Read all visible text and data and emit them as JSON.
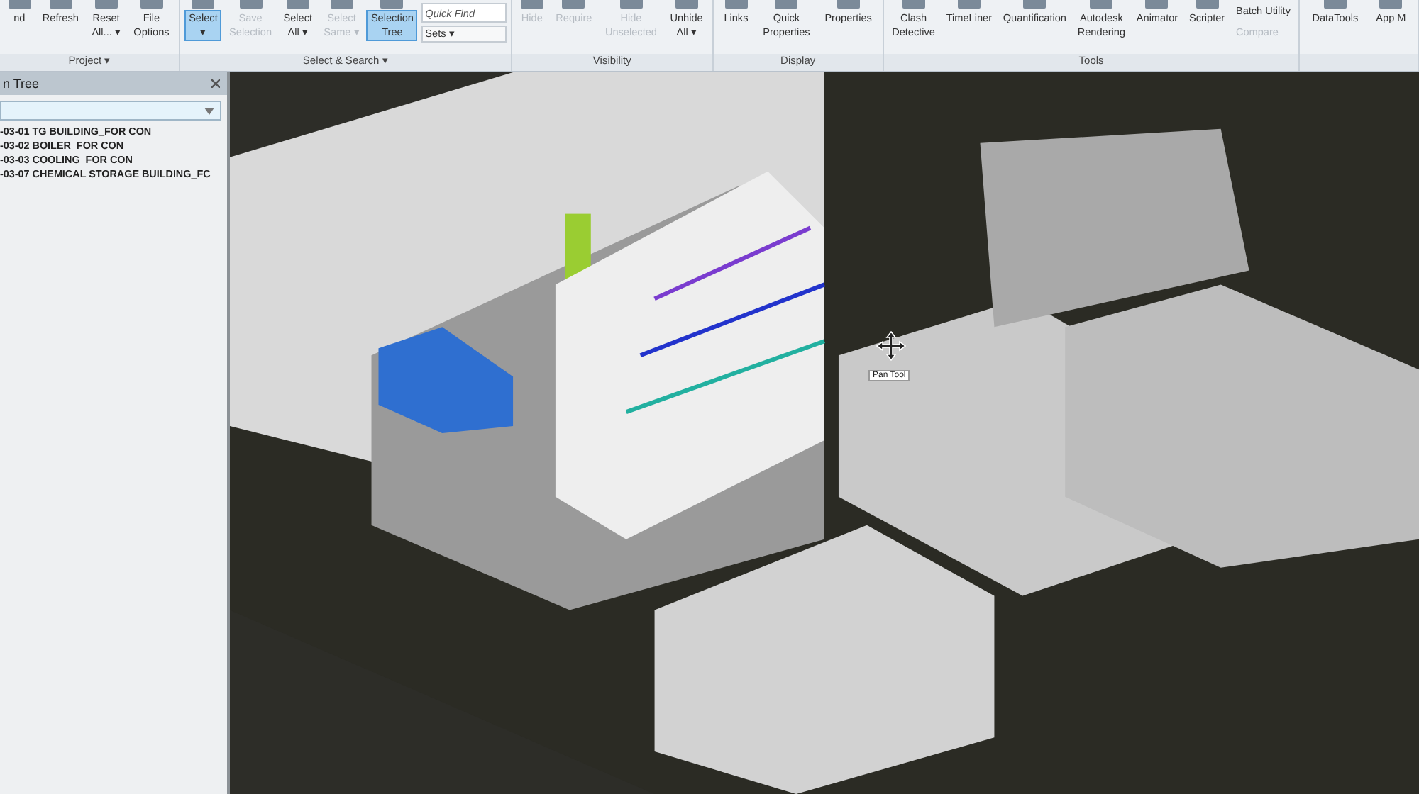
{
  "ribbon": {
    "groups": [
      {
        "label": "Project ▾",
        "items": [
          {
            "kind": "large",
            "label": "nd",
            "selected": false,
            "disabled": false
          },
          {
            "kind": "large",
            "label": "Refresh",
            "selected": false,
            "disabled": false
          },
          {
            "kind": "large",
            "label": "Reset\nAll... ▾",
            "selected": false,
            "disabled": false
          },
          {
            "kind": "large",
            "label": "File\nOptions",
            "selected": false,
            "disabled": false
          }
        ]
      },
      {
        "label": "Select & Search ▾",
        "items": [
          {
            "kind": "large",
            "label": "Select\n▾",
            "selected": true,
            "disabled": false
          },
          {
            "kind": "large",
            "label": "Save\nSelection",
            "selected": false,
            "disabled": true
          },
          {
            "kind": "large",
            "label": "Select\nAll ▾",
            "selected": false,
            "disabled": false
          },
          {
            "kind": "large",
            "label": "Select\nSame ▾",
            "selected": false,
            "disabled": true
          },
          {
            "kind": "large",
            "label": "Selection\nTree",
            "selected": true,
            "disabled": false
          },
          {
            "kind": "search",
            "placeholder": "Quick Find",
            "label": "Sets ▾",
            "selected": false,
            "disabled": false
          }
        ]
      },
      {
        "label": "Visibility",
        "items": [
          {
            "kind": "large",
            "label": "Hide",
            "selected": false,
            "disabled": true
          },
          {
            "kind": "large",
            "label": "Require",
            "selected": false,
            "disabled": true
          },
          {
            "kind": "large",
            "label": "Hide\nUnselected",
            "selected": false,
            "disabled": true
          },
          {
            "kind": "large",
            "label": "Unhide\nAll ▾",
            "selected": false,
            "disabled": false
          }
        ]
      },
      {
        "label": "Display",
        "items": [
          {
            "kind": "large",
            "label": "Links",
            "selected": false,
            "disabled": false
          },
          {
            "kind": "large",
            "label": "Quick\nProperties",
            "selected": false,
            "disabled": false
          },
          {
            "kind": "large",
            "label": "Properties",
            "selected": false,
            "disabled": false
          }
        ]
      },
      {
        "label": "Tools",
        "items": [
          {
            "kind": "large",
            "label": "Clash\nDetective",
            "selected": false,
            "disabled": false
          },
          {
            "kind": "large",
            "label": "TimeLiner",
            "selected": false,
            "disabled": false
          },
          {
            "kind": "large",
            "label": "Quantification",
            "selected": false,
            "disabled": false
          },
          {
            "kind": "large",
            "label": "Autodesk\nRendering",
            "selected": false,
            "disabled": false
          },
          {
            "kind": "large",
            "label": "Animator",
            "selected": false,
            "disabled": false
          },
          {
            "kind": "large",
            "label": "Scripter",
            "selected": false,
            "disabled": false
          },
          {
            "kind": "small",
            "label": "Batch Utility",
            "selected": false,
            "disabled": false
          },
          {
            "kind": "small",
            "label": "Compare",
            "selected": false,
            "disabled": true
          }
        ]
      },
      {
        "items": [
          {
            "kind": "large",
            "label": "DataTools",
            "selected": false,
            "disabled": false
          },
          {
            "kind": "large",
            "label": "App M",
            "selected": false,
            "disabled": false
          }
        ]
      }
    ]
  },
  "tree_panel": {
    "title": "n Tree",
    "items": [
      "-03-01 TG BUILDING_FOR CON",
      "-03-02 BOILER_FOR CON",
      "-03-03 COOLING_FOR CON",
      "-03-07 CHEMICAL STORAGE BUILDING_FC"
    ]
  },
  "viewport": {
    "tooltip": "Pan Tool"
  }
}
